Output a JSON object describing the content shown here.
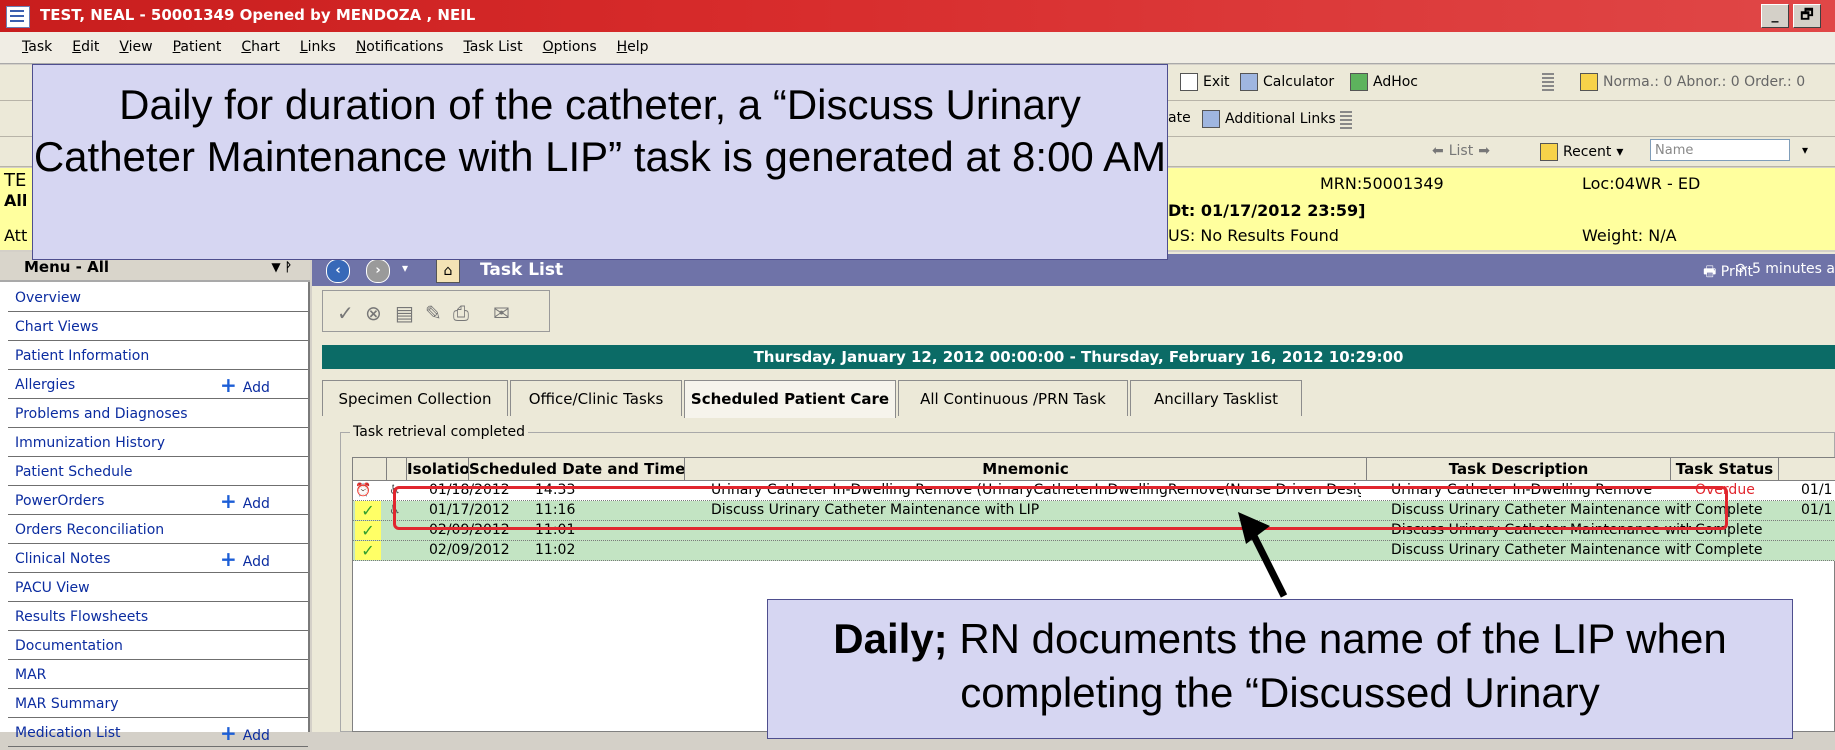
{
  "window": {
    "title": "TEST, NEAL - 50001349 Opened by MENDOZA , NEIL",
    "controls": [
      "_",
      "🗗"
    ]
  },
  "menubar": [
    "Task",
    "Edit",
    "View",
    "Patient",
    "Chart",
    "Links",
    "Notifications",
    "Task List",
    "Options",
    "Help"
  ],
  "toolbar1": {
    "exit": "Exit",
    "calculator": "Calculator",
    "adhoc": "AdHoc",
    "counts": "Norma.: 0  Abnor.: 0  Order.: 0"
  },
  "toolbar2": {
    "ate_partial": "ate",
    "additional_links": "Additional Links"
  },
  "toolbar3": {
    "list": "List",
    "recent": "Recent",
    "name_placeholder": "Name"
  },
  "banner": {
    "left1": "TE",
    "left2": "All",
    "left3": "Att",
    "dt": "Dt: 01/17/2012 23:59]",
    "us": "US: No Results Found",
    "mrn": "MRN:50001349",
    "loc": "Loc:04WR - ED",
    "weight": "Weight: N/A"
  },
  "leftmenu": {
    "header": "Menu - All",
    "add_label": "Add",
    "items": [
      {
        "label": "Overview",
        "add": false
      },
      {
        "label": "Chart Views",
        "add": false
      },
      {
        "label": "Patient Information",
        "add": false
      },
      {
        "label": "Allergies",
        "add": true
      },
      {
        "label": "Problems and Diagnoses",
        "add": false
      },
      {
        "label": "Immunization History",
        "add": false
      },
      {
        "label": "Patient Schedule",
        "add": false
      },
      {
        "label": "PowerOrders",
        "add": true
      },
      {
        "label": "Orders Reconciliation",
        "add": false
      },
      {
        "label": "Clinical Notes",
        "add": true
      },
      {
        "label": "PACU View",
        "add": false
      },
      {
        "label": "Results Flowsheets",
        "add": false
      },
      {
        "label": "Documentation",
        "add": false
      },
      {
        "label": "MAR",
        "add": false
      },
      {
        "label": "MAR Summary",
        "add": false
      },
      {
        "label": "Medication List",
        "add": true
      }
    ]
  },
  "tasklist": {
    "title": "Task List",
    "print": "Print",
    "refresh": "5 minutes a",
    "date_range": "Thursday, January 12, 2012 00:00:00 - Thursday, February 16, 2012 10:29:00",
    "tabs": [
      "Specimen Collection",
      "Office/Clinic Tasks",
      "Scheduled Patient Care",
      "All Continuous /PRN Task",
      "Ancillary Tasklist"
    ],
    "active_tab": 2,
    "panel_label": "Task retrieval completed",
    "columns": [
      "Isolatio",
      "Scheduled Date and Time",
      "Mnemonic",
      "Task Description",
      "Task Status"
    ],
    "rows": [
      {
        "date": "01/18/2012",
        "time": "14:33",
        "mnemonic": "Urinary Catheter In-Dwelling Remove (UrinaryCatheterInDwellingRemove(Nurse Driven Design))",
        "description": "Urinary Catheter In-Dwelling Remove",
        "status": "Overdue",
        "extra": "01/1"
      },
      {
        "date": "01/17/2012",
        "time": "11:16",
        "mnemonic": "Discuss Urinary Catheter Maintenance with LIP",
        "description": "Discuss Urinary Catheter Maintenance with",
        "status": "Complete",
        "extra": "01/1"
      },
      {
        "date": "02/09/2012",
        "time": "11:01",
        "mnemonic": "",
        "description": "Discuss Urinary Catheter Maintenance with",
        "status": "Complete",
        "extra": ""
      },
      {
        "date": "02/09/2012",
        "time": "11:02",
        "mnemonic": "",
        "description": "Discuss Urinary Catheter Maintenance with",
        "status": "Complete",
        "extra": ""
      }
    ]
  },
  "callouts": {
    "top": "Daily for duration of the catheter, a “Discuss Urinary Catheter Maintenance with LIP” task is generated at 8:00 AM",
    "bottom_bold": "Daily;",
    "bottom_rest": " RN documents the name of the LIP when completing the “Discussed Urinary"
  },
  "colors": {
    "titlebar": "#d72b2b",
    "banner": "#ffff9e",
    "tasklist_header": "#6f73a8",
    "daterange": "#0b6b66",
    "callout": "#d6d6f2",
    "highlight": "#e1262e",
    "overdue": "#e1262e"
  }
}
